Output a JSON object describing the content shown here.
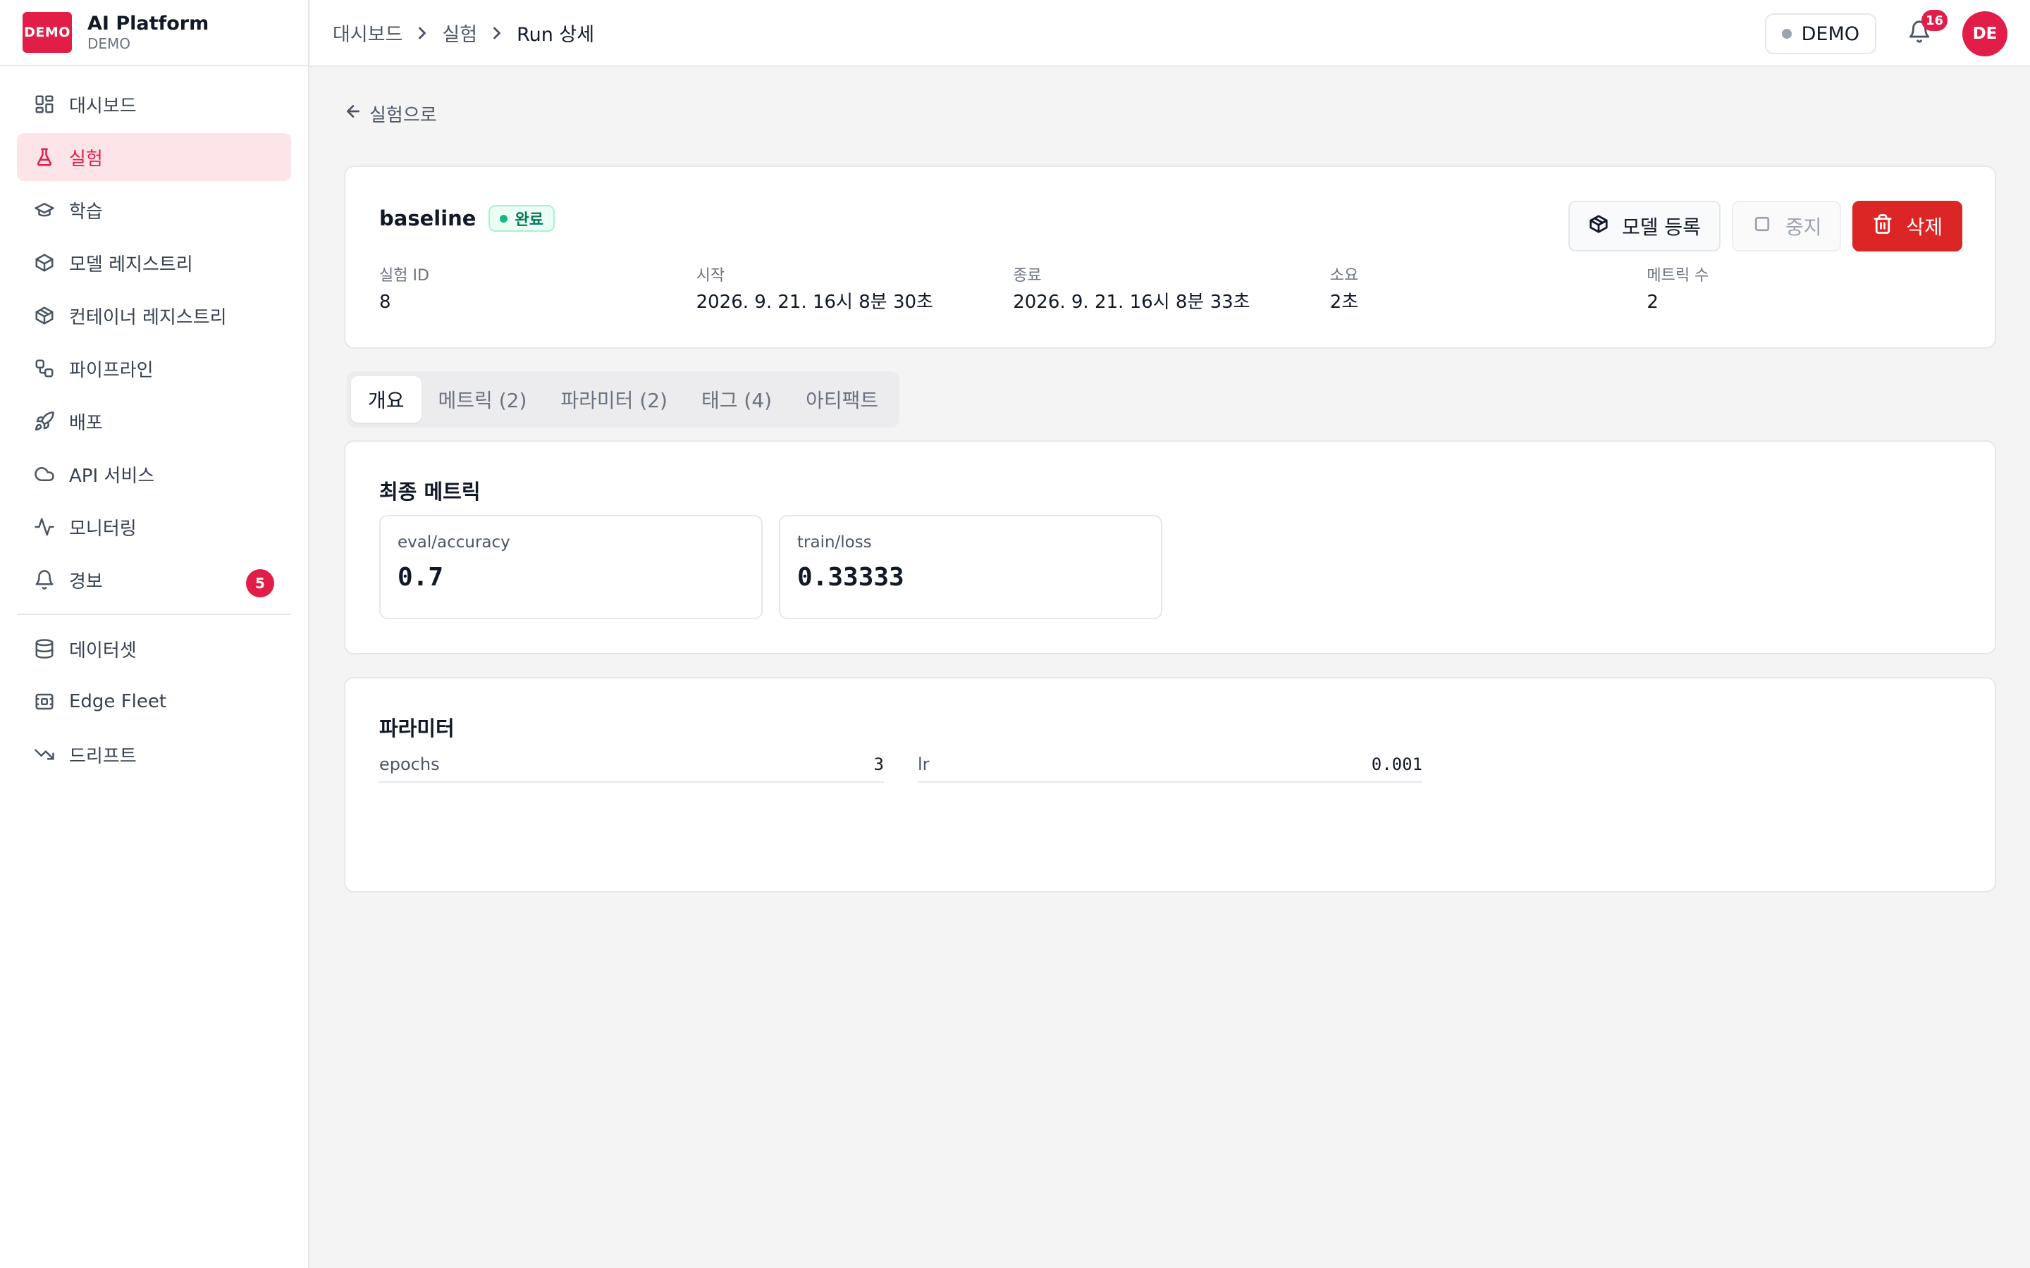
{
  "brand": {
    "logo_text": "DEMO",
    "name": "AI Platform",
    "sub": "DEMO"
  },
  "sidebar": {
    "items": [
      {
        "label": "대시보드",
        "icon": "dashboard-icon"
      },
      {
        "label": "실험",
        "icon": "flask-icon",
        "active": true
      },
      {
        "label": "학습",
        "icon": "graduation-cap-icon"
      },
      {
        "label": "모델 레지스트리",
        "icon": "box-icon"
      },
      {
        "label": "컨테이너 레지스트리",
        "icon": "container-icon"
      },
      {
        "label": "파이프라인",
        "icon": "workflow-icon"
      },
      {
        "label": "배포",
        "icon": "rocket-icon"
      },
      {
        "label": "API 서비스",
        "icon": "cloud-icon"
      },
      {
        "label": "모니터링",
        "icon": "activity-icon"
      },
      {
        "label": "경보",
        "icon": "bell-icon",
        "badge": "5"
      }
    ],
    "secondary": [
      {
        "label": "데이터셋",
        "icon": "database-icon"
      },
      {
        "label": "Edge Fleet",
        "icon": "edge-device-icon"
      },
      {
        "label": "드리프트",
        "icon": "trending-down-icon"
      }
    ]
  },
  "header": {
    "breadcrumb": [
      "대시보드",
      "실험",
      "Run 상세"
    ],
    "env_label": "DEMO",
    "notification_count": "16",
    "avatar_initials": "DE"
  },
  "main": {
    "back_label": "실험으로",
    "run": {
      "name": "baseline",
      "status": "완료",
      "meta": [
        {
          "label": "실험 ID",
          "value": "8"
        },
        {
          "label": "시작",
          "value": "2026. 9. 21. 16시 8분 30초"
        },
        {
          "label": "종료",
          "value": "2026. 9. 21. 16시 8분 33초"
        },
        {
          "label": "소요",
          "value": "2초"
        },
        {
          "label": "메트릭 수",
          "value": "2"
        }
      ],
      "actions": {
        "register": "모델 등록",
        "stop": "중지",
        "delete": "삭제"
      }
    },
    "tabs": [
      "개요",
      "메트릭 (2)",
      "파라미터 (2)",
      "태그 (4)",
      "아티팩트"
    ],
    "active_tab": "개요",
    "final_metrics": {
      "title": "최종 메트릭",
      "items": [
        {
          "name": "eval/accuracy",
          "value": "0.7"
        },
        {
          "name": "train/loss",
          "value": "0.33333"
        }
      ]
    },
    "parameters": {
      "title": "파라미터",
      "items": [
        {
          "key": "epochs",
          "value": "3"
        },
        {
          "key": "lr",
          "value": "0.001"
        }
      ]
    }
  },
  "colors": {
    "accent": "#e11d48",
    "danger": "#dc2626",
    "success": "#047857",
    "active_bg": "#fde4e8"
  }
}
